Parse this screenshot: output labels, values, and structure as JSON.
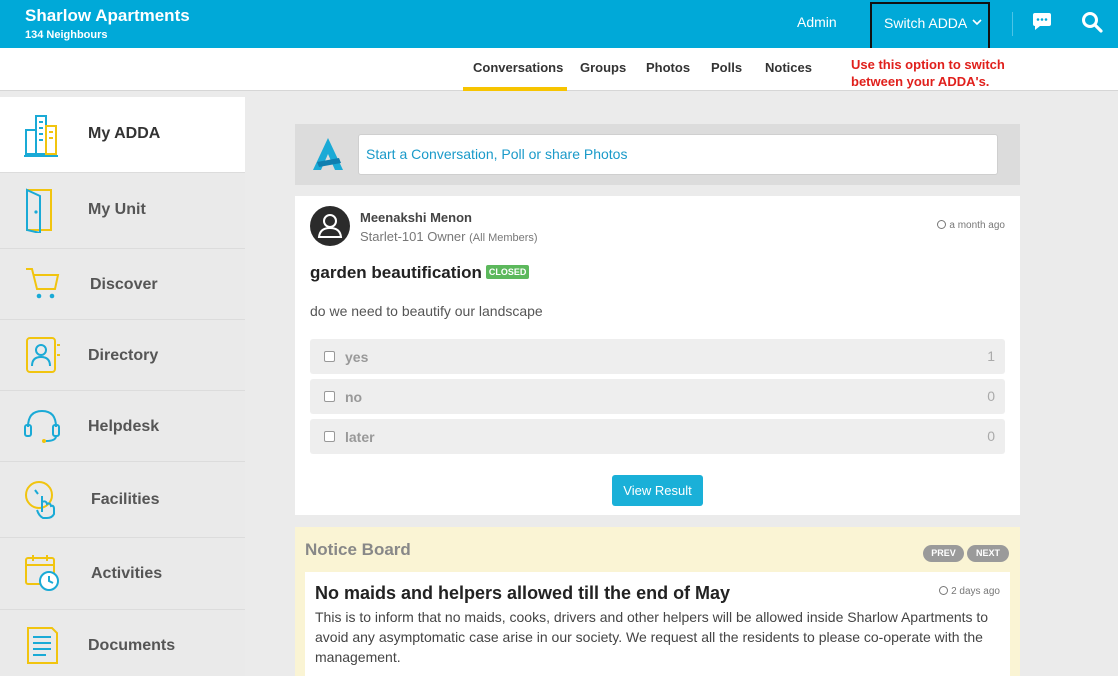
{
  "header": {
    "community_name": "Sharlow Apartments",
    "neighbours": "134 Neighbours",
    "admin_label": "Admin",
    "switch_label": "Switch ADDA"
  },
  "subnav": {
    "tabs": [
      "Conversations",
      "Groups",
      "Photos",
      "Polls",
      "Notices"
    ],
    "active_tab": "Conversations"
  },
  "hint": "Use this option to switch between your ADDA's.",
  "sidebar": {
    "items": [
      {
        "label": "My ADDA",
        "icon": "buildings-icon",
        "active": true
      },
      {
        "label": "My Unit",
        "icon": "door-icon"
      },
      {
        "label": "Discover",
        "icon": "cart-icon"
      },
      {
        "label": "Directory",
        "icon": "contact-book-icon"
      },
      {
        "label": "Helpdesk",
        "icon": "headset-icon"
      },
      {
        "label": "Facilities",
        "icon": "hand-pointer-icon"
      },
      {
        "label": "Activities",
        "icon": "calendar-clock-icon"
      },
      {
        "label": "Documents",
        "icon": "document-icon"
      }
    ]
  },
  "composer": {
    "placeholder": "Start a Conversation, Poll or share Photos"
  },
  "poll": {
    "author": "Meenakshi Menon",
    "role": "Starlet-101 Owner",
    "audience": "(All Members)",
    "time": "a month ago",
    "title": "garden beautification",
    "status": "CLOSED",
    "description": "do we need to beautify our landscape",
    "options": [
      {
        "label": "yes",
        "count": "1"
      },
      {
        "label": "no",
        "count": "0"
      },
      {
        "label": "later",
        "count": "0"
      }
    ],
    "button": "View Result"
  },
  "notice_board": {
    "title": "Notice Board",
    "prev": "PREV",
    "next": "NEXT",
    "headline": "No maids and helpers allowed till the end of May",
    "time": "2 days ago",
    "body": "This is to inform that no maids, cooks, drivers and other helpers will be allowed inside Sharlow Apartments to avoid any asymptomatic case arise in our society. We request all the residents to please co-operate with the management."
  },
  "colors": {
    "brand": "#00a9d8",
    "accent_yellow": "#f7c400",
    "hint_red": "#e0201c",
    "closed_green": "#5cb85c"
  }
}
